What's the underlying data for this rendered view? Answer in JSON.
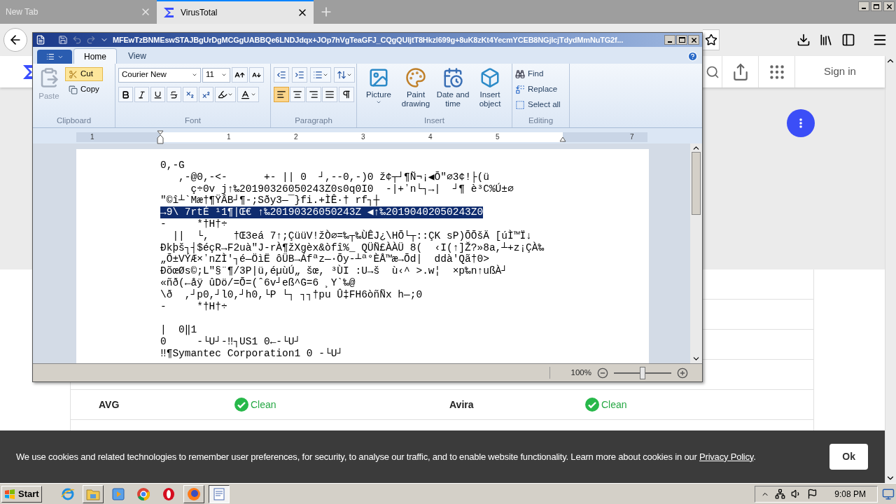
{
  "browser": {
    "tabs": [
      {
        "label": "New Tab",
        "selected": false
      },
      {
        "label": "VirusTotal",
        "selected": true
      }
    ]
  },
  "site": {
    "sign_in": "Sign in",
    "results": [
      {
        "engine": "AVG",
        "result": "Clean"
      },
      {
        "engine": "Avira",
        "result": "Clean"
      }
    ]
  },
  "cookie_banner": {
    "text": "We use cookies and related technologies to remember user preferences, for security, to analyse our traffic, and to enable website functionality. Learn more about cookies in our ",
    "link": "Privacy Policy",
    "end": ".",
    "button": "Ok"
  },
  "wordpad": {
    "title": "MFEwTzBNMEswSTAJBgUrDgMCGgUABBQe6LNDJdqx+JOp7hVgTeaGFJ_CQgQUljtT8Hkzl699g+8uK8zKt4YecmYCEB8NGjlcjTdydMmNuTG2f...",
    "ribbon_tabs": [
      {
        "label": "Home",
        "selected": true
      },
      {
        "label": "View",
        "selected": false
      }
    ],
    "clipboard": {
      "label": "Clipboard",
      "paste": {
        "label": "Paste",
        "disabled": true
      },
      "cut": {
        "label": "Cut",
        "highlighted": true
      },
      "copy": {
        "label": "Copy",
        "highlighted": false
      }
    },
    "font": {
      "label": "Font",
      "name": "Courier New",
      "size": "11"
    },
    "paragraph": {
      "label": "Paragraph",
      "alignments": [
        {
          "kind": "left",
          "selected": true
        },
        {
          "kind": "center",
          "selected": false
        },
        {
          "kind": "right",
          "selected": false
        },
        {
          "kind": "justify",
          "selected": false
        }
      ]
    },
    "insert": {
      "label": "Insert",
      "items": [
        {
          "kind": "picture",
          "label": "Picture"
        },
        {
          "kind": "paint",
          "label": "Paint drawing"
        },
        {
          "kind": "datetime",
          "label": "Date and time"
        },
        {
          "kind": "object",
          "label": "Insert object"
        }
      ]
    },
    "editing": {
      "label": "Editing",
      "items": [
        {
          "kind": "find",
          "label": "Find"
        },
        {
          "kind": "replace",
          "label": "Replace"
        },
        {
          "kind": "select",
          "label": "Select all"
        }
      ]
    },
    "ruler": [
      "1",
      "1",
      "2",
      "3",
      "4",
      "5",
      "7"
    ],
    "lines": [
      {
        "kind": "text",
        "text": "0,-G",
        "selected": false
      },
      {
        "kind": "text",
        "text": "   ,-@0,-<-      +- || 0  ┘,--0,-)0 ž¢┬┘¶Ñ¬¡◀Õ″⌀3¢!├(ü",
        "selected": false
      },
      {
        "kind": "text",
        "text": "     ç÷0v j↑‰20190326050243Z0s0q0I0  -|+ʼn└┐→|  ┘¶ è³C%Ú±⌀",
        "selected": false
      },
      {
        "kind": "text",
        "text": "\"©î┴`Mæ†¶ŸÂB┘¶-;Sðy3—¯}fi.+ÌÊ·† rf┐┼",
        "selected": false
      },
      {
        "kind": "text",
        "text": "→9\\ 7rtÉ ¹1¶|Œ€ ↑‰20190326050243Z ◀↑‰20190402050243Z0",
        "selected": true
      },
      {
        "kind": "text",
        "text": "-     *†H†÷",
        "selected": false
      },
      {
        "kind": "text",
        "text": "  ||  └,    †Œ3eá 7↑;ÇüüV!žÒ⌀=‰┬‰ÙÊJ¿\\HÕ└┬::ÇK sP)ÕÕšÄ [úÌ™Ï↓",
        "selected": false
      },
      {
        "kind": "text",
        "text": "Ðkþš┐┤$éçR→F2uà″J-rÀ¶žXgèx&òfî%_ QÜÑ£ÀÀÜ 8(  ‹I(↑]Ž?»8a,┴+z¡ÇÀ‰",
        "selected": false
      },
      {
        "kind": "text",
        "text": "„Õ±VÝÆ×ʼnZÌ'┐é—ÖìË ôÜB→Áfªz—·Õy-┴ª°ÈÅ™æ→Õd|  ddà'Qã†0>",
        "selected": false
      },
      {
        "kind": "text",
        "text": "ÐõœØs©;L\"§¨¶/3P|ü,éµùÚ„ šœ, ³ÙI :U→š  ù‹^ >.w¦  ×p‰n↑ußÀ┘",
        "selected": false
      },
      {
        "kind": "text",
        "text": "«ñð(←åÿ ûDö/=Õ=(ˆ6v┘eß^G=6 ¸Y`‰@",
        "selected": false
      },
      {
        "kind": "text",
        "text": "\\ð  ,┘p0,┘l0,┘h0,└P └┐ ┐┐†pu Û‡FH6òñÑx h—;0",
        "selected": false
      },
      {
        "kind": "text",
        "text": "-     *†H†÷",
        "selected": false
      },
      {
        "kind": "blank"
      },
      {
        "kind": "text",
        "text": "|  0‖1",
        "selected": false
      },
      {
        "kind": "text",
        "text": "0     -└U┘-‼┐US1 0←-└U┘",
        "selected": false
      },
      {
        "kind": "text",
        "text": "‼¶Symantec Corporation1 0 -└U┘",
        "selected": false
      }
    ],
    "zoom": {
      "reading": "100%",
      "level": 0.5
    }
  },
  "taskbar": {
    "start": "Start",
    "clock": "9:08 PM",
    "apps": [
      {
        "kind": "ie",
        "running": false,
        "selected": false
      },
      {
        "kind": "explorer",
        "running": true,
        "selected": false
      },
      {
        "kind": "media",
        "running": false,
        "selected": false
      },
      {
        "kind": "chrome",
        "running": false,
        "selected": false
      },
      {
        "kind": "opera",
        "running": false,
        "selected": false
      },
      {
        "kind": "firefox",
        "running": true,
        "selected": false
      },
      {
        "kind": "wordpad",
        "running": true,
        "selected": true
      }
    ]
  }
}
